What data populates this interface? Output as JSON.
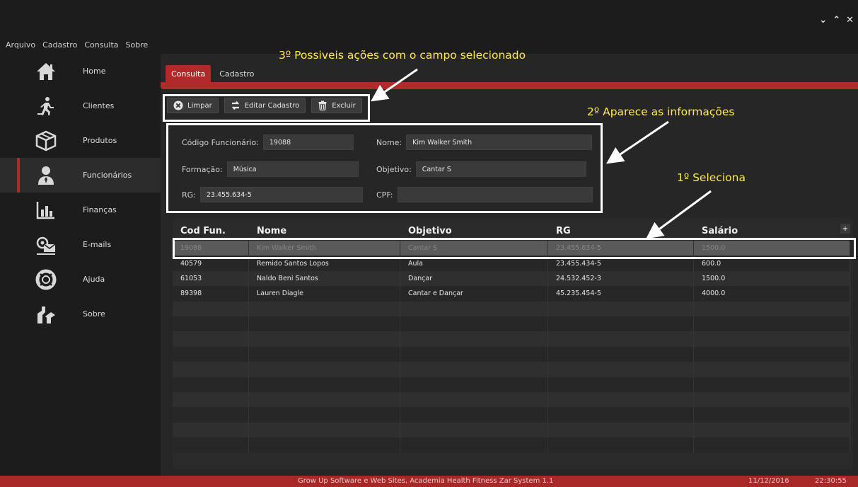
{
  "window_controls": {
    "minimize": "⌄",
    "maximize": "⌃",
    "close": "✕"
  },
  "menu": [
    "Arquivo",
    "Cadastro",
    "Consulta",
    "Sobre"
  ],
  "sidebar": {
    "items": [
      {
        "label": "Home",
        "icon": "home-icon"
      },
      {
        "label": "Clientes",
        "icon": "runner-icon"
      },
      {
        "label": "Produtos",
        "icon": "box-icon"
      },
      {
        "label": "Funcionários",
        "icon": "employee-icon",
        "active": true
      },
      {
        "label": "Finanças",
        "icon": "bar-chart-icon"
      },
      {
        "label": "E-mails",
        "icon": "email-icon"
      },
      {
        "label": "Ajuda",
        "icon": "lifebuoy-icon"
      },
      {
        "label": "Sobre",
        "icon": "puzzle-icon"
      }
    ]
  },
  "tabs": [
    "Consulta",
    "Cadastro"
  ],
  "toolbar": {
    "clear_label": "Limpar",
    "edit_label": "Editar Cadastro",
    "delete_label": "Excluir"
  },
  "form": {
    "codigo_label": "Código Funcionário:",
    "codigo_value": "19088",
    "nome_label": "Nome:",
    "nome_value": "Kim Walker Smith",
    "formacao_label": "Formação:",
    "formacao_value": "Música",
    "objetivo_label": "Objetivo:",
    "objetivo_value": "Cantar S",
    "rg_label": "RG:",
    "rg_value": "23.455.634-5",
    "cpf_label": "CPF:",
    "cpf_value": ""
  },
  "table": {
    "headers": [
      "Cod Fun.",
      "Nome",
      "Objetivo",
      "RG",
      "Salário"
    ],
    "rows": [
      [
        "19088",
        "Kim Walker Smith",
        "Cantar S",
        "23.455.634-5",
        "1500.0"
      ],
      [
        "40579",
        "Remido Santos Lopos",
        "Aula",
        "23.455.434-5",
        "600.0"
      ],
      [
        "61053",
        "Naldo Beni Santos",
        "Dançar",
        "24.532.452-3",
        "1500.0"
      ],
      [
        "89398",
        "Lauren Diagle",
        "Cantar e Dançar",
        "45.235.454-5",
        "4000.0"
      ]
    ],
    "selected_row": 0,
    "empty_rows": 10,
    "add_column_label": "+"
  },
  "status": {
    "center": "Grow Up Software e Web Sites, Academia Health Fitness Zar System 1.1",
    "date": "11/12/2016",
    "time": "22:30:55"
  },
  "annotations": {
    "step3": "3º Possiveis ações com o campo selecionado",
    "step2": "2º Aparece as informações",
    "step1": "1º Seleciona"
  },
  "colors": {
    "accent": "#b02a2a",
    "annotation_text": "#ffe94a",
    "background": "#1c1c1c"
  }
}
